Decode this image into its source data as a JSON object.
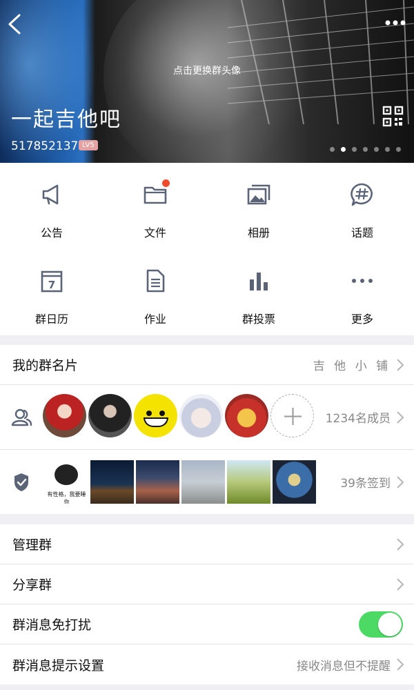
{
  "header": {
    "hint": "点击更换群头像",
    "group_name": "一起吉他吧",
    "group_id": "517852137",
    "level": "LV5",
    "pager_count": 7,
    "pager_active_index": 1
  },
  "grid": {
    "items": [
      {
        "label": "公告",
        "icon": "megaphone-icon"
      },
      {
        "label": "文件",
        "icon": "folder-icon",
        "badge": true
      },
      {
        "label": "相册",
        "icon": "album-icon"
      },
      {
        "label": "话题",
        "icon": "hashtag-bubble-icon"
      },
      {
        "label": "群日历",
        "icon": "calendar-icon",
        "calendar_day": "7"
      },
      {
        "label": "作业",
        "icon": "document-icon"
      },
      {
        "label": "群投票",
        "icon": "bar-chart-icon"
      },
      {
        "label": "更多",
        "icon": "more-dots-icon"
      }
    ]
  },
  "card": {
    "title": "我的群名片",
    "value": "吉 他 小 铺"
  },
  "members": {
    "count_label": "1234名成员",
    "checkin_label": "39条签到",
    "thumb_caption": "有性格，我要睡你"
  },
  "settings": {
    "manage": "管理群",
    "share": "分享群",
    "mute": "群消息免打扰",
    "mute_on": true,
    "notify": "群消息提示设置",
    "notify_value": "接收消息但不提醒"
  },
  "colors": {
    "accent_green": "#4cd964",
    "badge_red": "#f04b2c",
    "icon_gray": "#5b6477"
  }
}
